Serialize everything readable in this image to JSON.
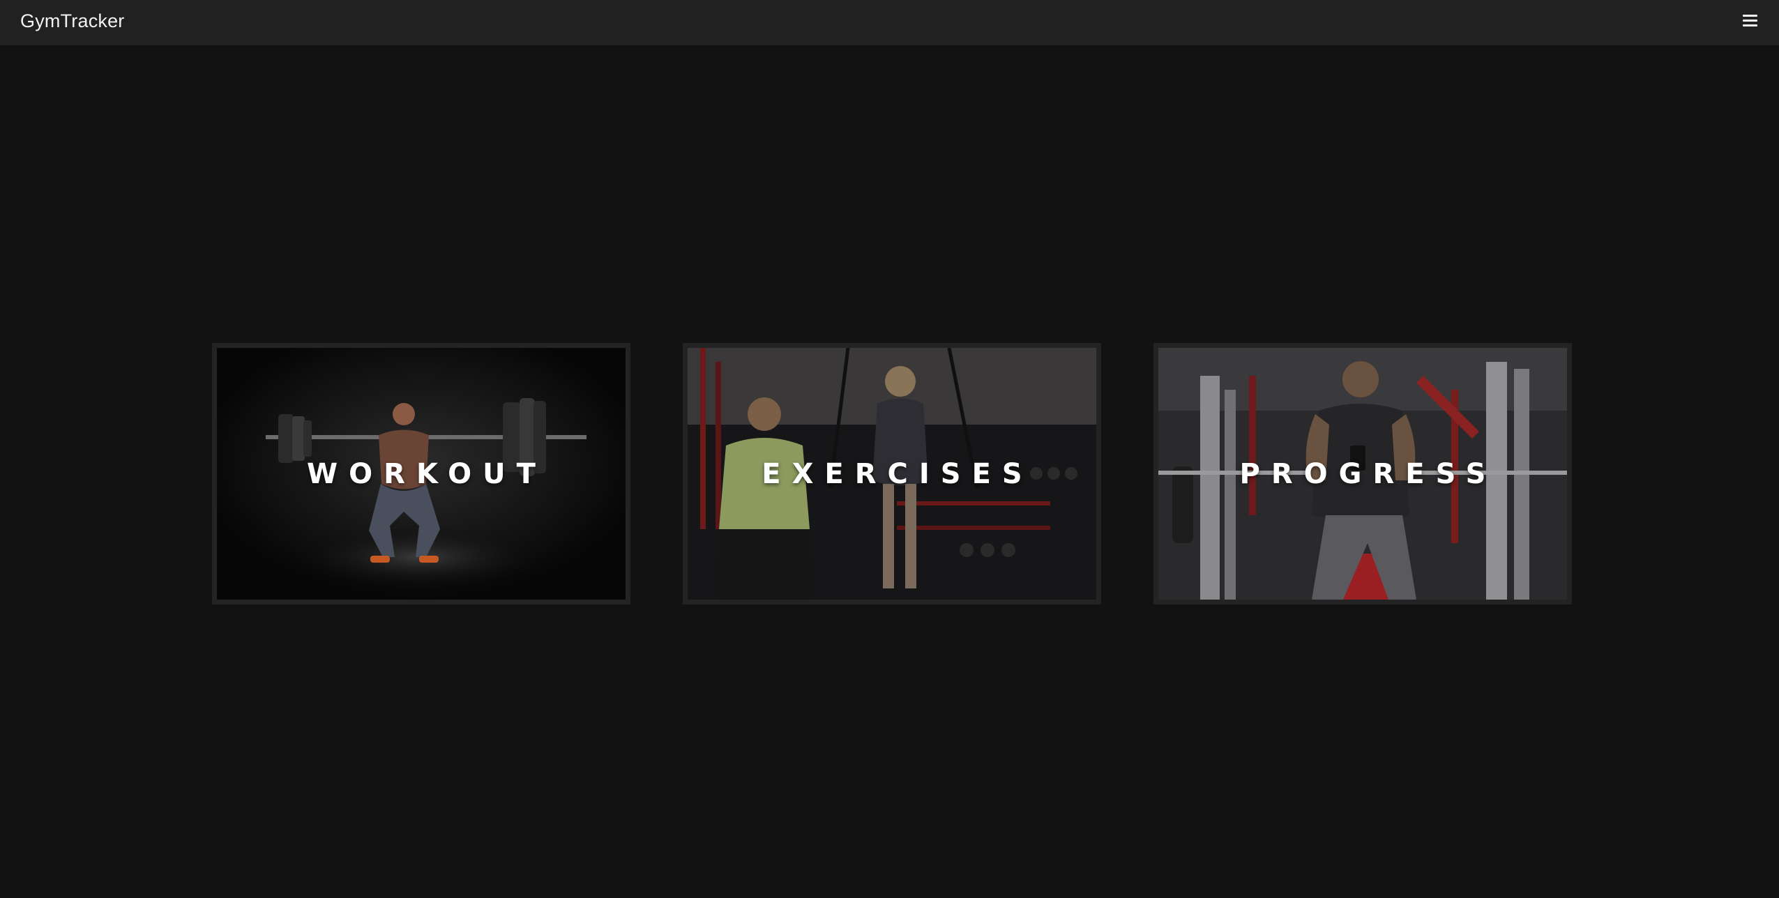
{
  "app": {
    "title": "GymTracker"
  },
  "navbar": {
    "brand": "GymTracker",
    "menu_icon": "hamburger-menu-icon"
  },
  "cards": [
    {
      "label": "WORKOUT",
      "image": "barbell-squat-photo"
    },
    {
      "label": "EXERCISES",
      "image": "trx-training-photo"
    },
    {
      "label": "PROGRESS",
      "image": "gym-machine-phone-photo"
    }
  ],
  "colors": {
    "page_background": "#121212",
    "navbar_background": "#212121",
    "card_frame": "#232323",
    "text": "#ffffff"
  }
}
